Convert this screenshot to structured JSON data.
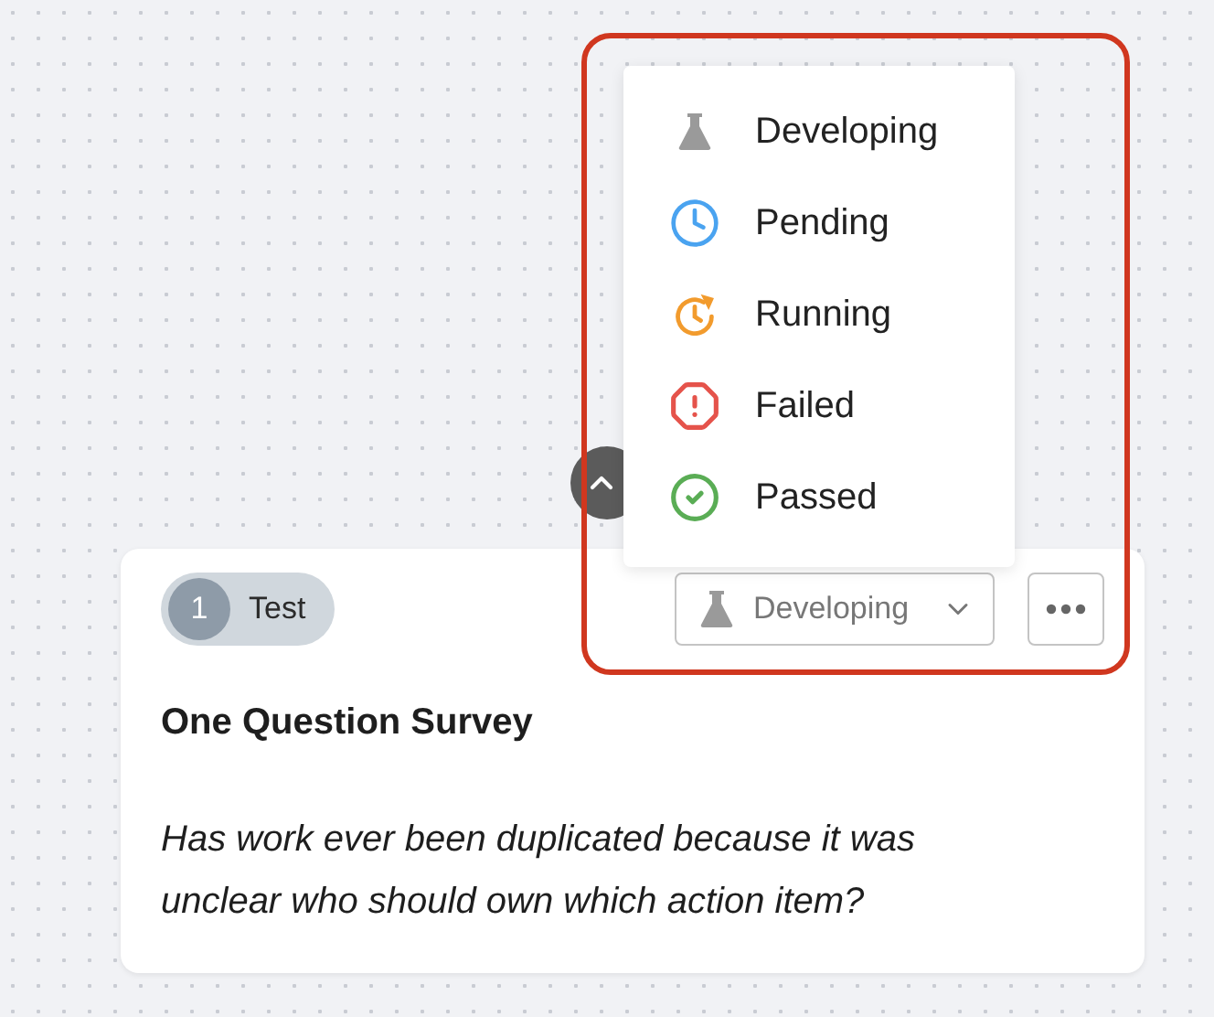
{
  "status_menu": {
    "open": true,
    "items": [
      {
        "label": "Developing",
        "kind": "developing",
        "color": "#9a9a9a"
      },
      {
        "label": "Pending",
        "kind": "pending",
        "color": "#4aa3f0"
      },
      {
        "label": "Running",
        "kind": "running",
        "color": "#f29b2d"
      },
      {
        "label": "Failed",
        "kind": "failed",
        "color": "#e5534b"
      },
      {
        "label": "Passed",
        "kind": "passed",
        "color": "#5aad55"
      }
    ]
  },
  "annotation": {
    "kind": "outline"
  },
  "card": {
    "badge": {
      "number": "1",
      "label": "Test"
    },
    "status": {
      "label": "Developing",
      "kind": "developing"
    },
    "title": "One Question Survey",
    "question": "Has work ever been duplicated because it was unclear who should own which action item?"
  }
}
